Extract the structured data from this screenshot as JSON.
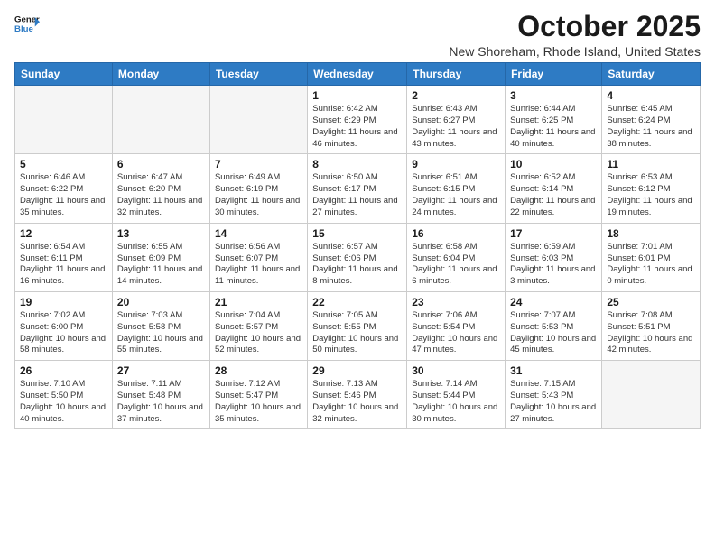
{
  "logo": {
    "line1": "General",
    "line2": "Blue"
  },
  "title": "October 2025",
  "location": "New Shoreham, Rhode Island, United States",
  "weekdays": [
    "Sunday",
    "Monday",
    "Tuesday",
    "Wednesday",
    "Thursday",
    "Friday",
    "Saturday"
  ],
  "weeks": [
    [
      {
        "day": "",
        "info": ""
      },
      {
        "day": "",
        "info": ""
      },
      {
        "day": "",
        "info": ""
      },
      {
        "day": "1",
        "info": "Sunrise: 6:42 AM\nSunset: 6:29 PM\nDaylight: 11 hours\nand 46 minutes."
      },
      {
        "day": "2",
        "info": "Sunrise: 6:43 AM\nSunset: 6:27 PM\nDaylight: 11 hours\nand 43 minutes."
      },
      {
        "day": "3",
        "info": "Sunrise: 6:44 AM\nSunset: 6:25 PM\nDaylight: 11 hours\nand 40 minutes."
      },
      {
        "day": "4",
        "info": "Sunrise: 6:45 AM\nSunset: 6:24 PM\nDaylight: 11 hours\nand 38 minutes."
      }
    ],
    [
      {
        "day": "5",
        "info": "Sunrise: 6:46 AM\nSunset: 6:22 PM\nDaylight: 11 hours\nand 35 minutes."
      },
      {
        "day": "6",
        "info": "Sunrise: 6:47 AM\nSunset: 6:20 PM\nDaylight: 11 hours\nand 32 minutes."
      },
      {
        "day": "7",
        "info": "Sunrise: 6:49 AM\nSunset: 6:19 PM\nDaylight: 11 hours\nand 30 minutes."
      },
      {
        "day": "8",
        "info": "Sunrise: 6:50 AM\nSunset: 6:17 PM\nDaylight: 11 hours\nand 27 minutes."
      },
      {
        "day": "9",
        "info": "Sunrise: 6:51 AM\nSunset: 6:15 PM\nDaylight: 11 hours\nand 24 minutes."
      },
      {
        "day": "10",
        "info": "Sunrise: 6:52 AM\nSunset: 6:14 PM\nDaylight: 11 hours\nand 22 minutes."
      },
      {
        "day": "11",
        "info": "Sunrise: 6:53 AM\nSunset: 6:12 PM\nDaylight: 11 hours\nand 19 minutes."
      }
    ],
    [
      {
        "day": "12",
        "info": "Sunrise: 6:54 AM\nSunset: 6:11 PM\nDaylight: 11 hours\nand 16 minutes."
      },
      {
        "day": "13",
        "info": "Sunrise: 6:55 AM\nSunset: 6:09 PM\nDaylight: 11 hours\nand 14 minutes."
      },
      {
        "day": "14",
        "info": "Sunrise: 6:56 AM\nSunset: 6:07 PM\nDaylight: 11 hours\nand 11 minutes."
      },
      {
        "day": "15",
        "info": "Sunrise: 6:57 AM\nSunset: 6:06 PM\nDaylight: 11 hours\nand 8 minutes."
      },
      {
        "day": "16",
        "info": "Sunrise: 6:58 AM\nSunset: 6:04 PM\nDaylight: 11 hours\nand 6 minutes."
      },
      {
        "day": "17",
        "info": "Sunrise: 6:59 AM\nSunset: 6:03 PM\nDaylight: 11 hours\nand 3 minutes."
      },
      {
        "day": "18",
        "info": "Sunrise: 7:01 AM\nSunset: 6:01 PM\nDaylight: 11 hours\nand 0 minutes."
      }
    ],
    [
      {
        "day": "19",
        "info": "Sunrise: 7:02 AM\nSunset: 6:00 PM\nDaylight: 10 hours\nand 58 minutes."
      },
      {
        "day": "20",
        "info": "Sunrise: 7:03 AM\nSunset: 5:58 PM\nDaylight: 10 hours\nand 55 minutes."
      },
      {
        "day": "21",
        "info": "Sunrise: 7:04 AM\nSunset: 5:57 PM\nDaylight: 10 hours\nand 52 minutes."
      },
      {
        "day": "22",
        "info": "Sunrise: 7:05 AM\nSunset: 5:55 PM\nDaylight: 10 hours\nand 50 minutes."
      },
      {
        "day": "23",
        "info": "Sunrise: 7:06 AM\nSunset: 5:54 PM\nDaylight: 10 hours\nand 47 minutes."
      },
      {
        "day": "24",
        "info": "Sunrise: 7:07 AM\nSunset: 5:53 PM\nDaylight: 10 hours\nand 45 minutes."
      },
      {
        "day": "25",
        "info": "Sunrise: 7:08 AM\nSunset: 5:51 PM\nDaylight: 10 hours\nand 42 minutes."
      }
    ],
    [
      {
        "day": "26",
        "info": "Sunrise: 7:10 AM\nSunset: 5:50 PM\nDaylight: 10 hours\nand 40 minutes."
      },
      {
        "day": "27",
        "info": "Sunrise: 7:11 AM\nSunset: 5:48 PM\nDaylight: 10 hours\nand 37 minutes."
      },
      {
        "day": "28",
        "info": "Sunrise: 7:12 AM\nSunset: 5:47 PM\nDaylight: 10 hours\nand 35 minutes."
      },
      {
        "day": "29",
        "info": "Sunrise: 7:13 AM\nSunset: 5:46 PM\nDaylight: 10 hours\nand 32 minutes."
      },
      {
        "day": "30",
        "info": "Sunrise: 7:14 AM\nSunset: 5:44 PM\nDaylight: 10 hours\nand 30 minutes."
      },
      {
        "day": "31",
        "info": "Sunrise: 7:15 AM\nSunset: 5:43 PM\nDaylight: 10 hours\nand 27 minutes."
      },
      {
        "day": "",
        "info": ""
      }
    ]
  ]
}
